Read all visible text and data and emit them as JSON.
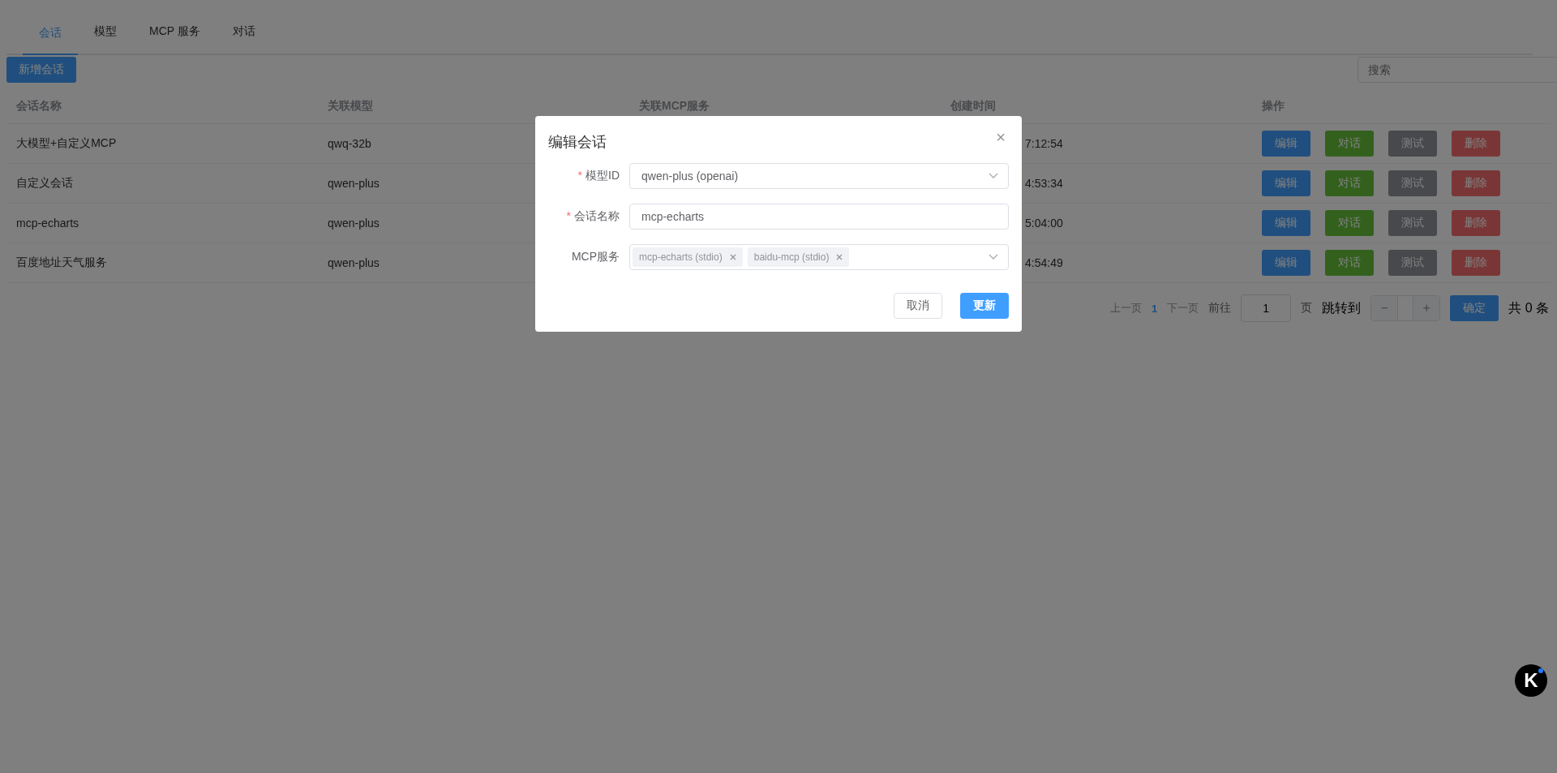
{
  "tabs": [
    {
      "label": "会话",
      "selected": true
    },
    {
      "label": "模型",
      "selected": false
    },
    {
      "label": "MCP 服务",
      "selected": false
    },
    {
      "label": "对话",
      "selected": false
    }
  ],
  "toolbar": {
    "add_button": "新增会话",
    "search": {
      "placeholder": "搜索"
    }
  },
  "table": {
    "columns": [
      "会话名称",
      "关联模型",
      "关联MCP服务",
      "创建时间",
      "操作"
    ],
    "rows": [
      {
        "name": "大模型+自定义MCP",
        "model": "qwq-32b",
        "created": "7:12:54",
        "actions": [
          {
            "label": "编辑",
            "kind": "edit"
          },
          {
            "label": "对话",
            "kind": "chat"
          },
          {
            "label": "测试",
            "kind": "test"
          },
          {
            "label": "删除",
            "kind": "delete"
          }
        ]
      },
      {
        "name": "自定义会话",
        "model": "qwen-plus",
        "created": "4:53:34",
        "actions": [
          {
            "label": "编辑",
            "kind": "edit"
          },
          {
            "label": "对话",
            "kind": "chat"
          },
          {
            "label": "测试",
            "kind": "test"
          },
          {
            "label": "删除",
            "kind": "delete"
          }
        ]
      },
      {
        "name": "mcp-echarts",
        "model": "qwen-plus",
        "created": "5:04:00",
        "actions": [
          {
            "label": "编辑",
            "kind": "edit"
          },
          {
            "label": "对话",
            "kind": "chat"
          },
          {
            "label": "测试",
            "kind": "test"
          },
          {
            "label": "删除",
            "kind": "delete"
          }
        ]
      },
      {
        "name": "百度地址天气服务",
        "model": "qwen-plus",
        "created": "4:54:49",
        "actions": [
          {
            "label": "编辑",
            "kind": "edit"
          },
          {
            "label": "对话",
            "kind": "chat"
          },
          {
            "label": "测试",
            "kind": "test"
          },
          {
            "label": "删除",
            "kind": "delete"
          }
        ]
      }
    ]
  },
  "pagination": {
    "prev": "上一页",
    "pages": [
      {
        "label": "1",
        "selected": true
      }
    ],
    "next": "下一页",
    "goto_label": "前往",
    "goto_value": "1",
    "page_unit": "页",
    "jump_label": "跳转到",
    "minus": "−",
    "plus": "+",
    "confirm": "确定",
    "total": "共 0 条"
  },
  "dialog": {
    "title": "编辑会话",
    "close": "×",
    "fields": [
      {
        "kind": "select",
        "label": "模型ID",
        "required_mark": "*",
        "value": "qwen-plus (openai)"
      },
      {
        "kind": "input",
        "label": "会话名称",
        "required_mark": "*",
        "value": "mcp-echarts"
      },
      {
        "kind": "multiselect",
        "label": "MCP服务",
        "tags": [
          "mcp-echarts (stdio)",
          "baidu-mcp (stdio)"
        ]
      }
    ],
    "cancel": "取消",
    "submit": "更新"
  },
  "floating_logo": {
    "letter": "K"
  }
}
